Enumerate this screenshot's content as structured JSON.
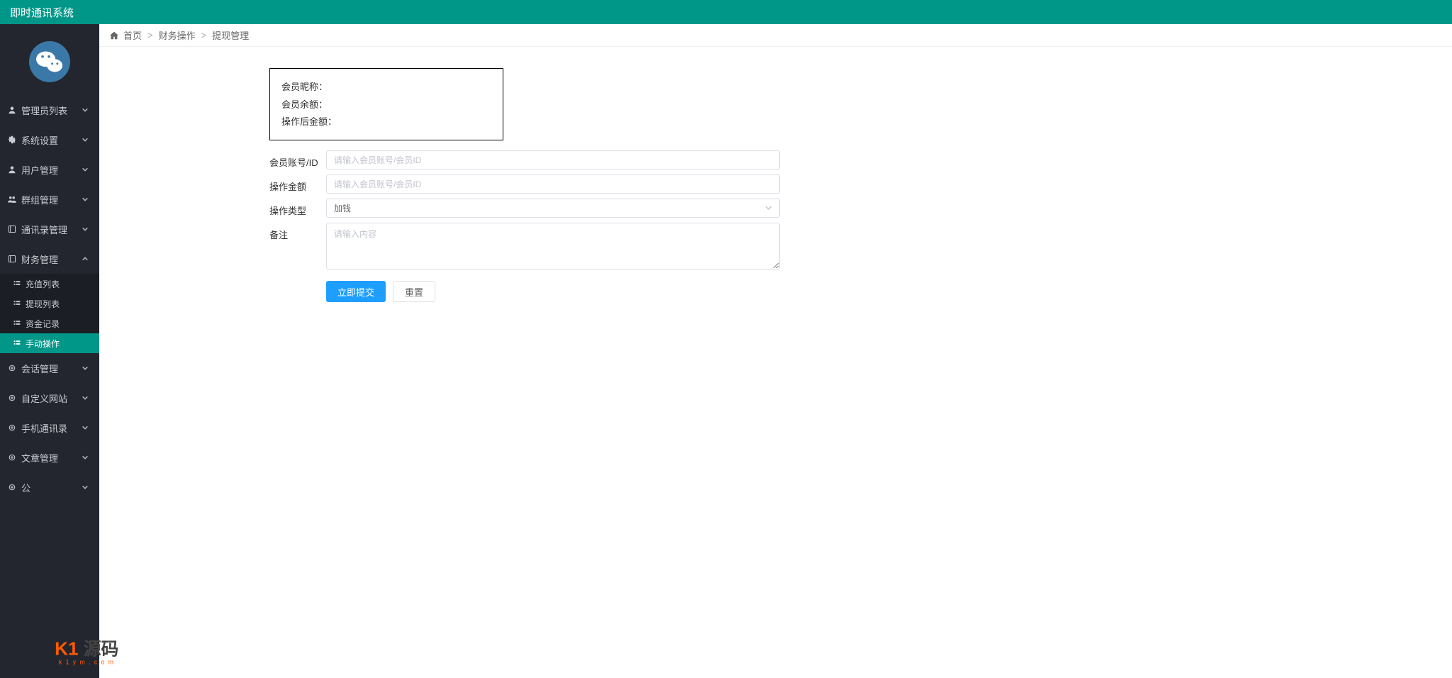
{
  "app": {
    "title": "即时通讯系统"
  },
  "sidebar": {
    "items": [
      {
        "icon": "user",
        "label": "管理员列表"
      },
      {
        "icon": "gear",
        "label": "系统设置"
      },
      {
        "icon": "user",
        "label": "用户管理"
      },
      {
        "icon": "users",
        "label": "群组管理"
      },
      {
        "icon": "book",
        "label": "通讯录管理"
      },
      {
        "icon": "book",
        "label": "财务管理",
        "expanded": true,
        "children": [
          {
            "label": "充值列表"
          },
          {
            "label": "提现列表"
          },
          {
            "label": "资金记录"
          },
          {
            "label": "手动操作",
            "active": true
          }
        ]
      },
      {
        "icon": "link",
        "label": "会话管理"
      },
      {
        "icon": "link",
        "label": "自定义网站"
      },
      {
        "icon": "link",
        "label": "手机通讯录"
      },
      {
        "icon": "link",
        "label": "文章管理"
      },
      {
        "icon": "link",
        "label": "公"
      }
    ]
  },
  "breadcrumb": {
    "home": "首页",
    "a": "财务操作",
    "b": "提现管理"
  },
  "info": {
    "nickname_label": "会员昵称：",
    "balance_label": "会员余额：",
    "after_label": "操作后金额："
  },
  "form": {
    "account_label": "会员账号/ID",
    "account_placeholder": "请输入会员账号/会员ID",
    "amount_label": "操作金额",
    "amount_placeholder": "请输入会员账号/会员ID",
    "type_label": "操作类型",
    "type_value": "加钱",
    "remark_label": "备注",
    "remark_placeholder": "请输入内容",
    "submit": "立即提交",
    "reset": "重置"
  },
  "watermark": {
    "brand_left": "K1",
    "brand_right": "源码",
    "url": "k 1 y m . c o m"
  }
}
